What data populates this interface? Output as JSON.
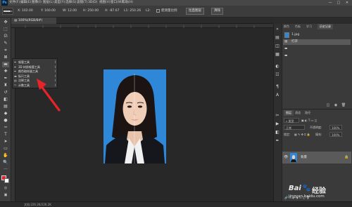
{
  "app": {
    "logo_text": "Ps"
  },
  "menubar": {
    "items": [
      "文件(F)",
      "编辑(E)",
      "图像(I)",
      "图层(L)",
      "类型(Y)",
      "选择(S)",
      "滤镜(T)",
      "3D(D)",
      "视图(V)",
      "窗口(W)",
      "帮助(H)"
    ],
    "window_controls": [
      "—",
      "□",
      "✕"
    ]
  },
  "options": {
    "x_field": "X: 102.00",
    "y_field": "Y: 160.00",
    "w_field": "W: 12.00",
    "h_field": "H: 250.00",
    "a_field": "A: -87.67",
    "l_field": "L1: 250.26",
    "l2_field": "L2:",
    "scale_label": "使测量比例",
    "straighten_button": "拉直图层",
    "clear_button": "清除"
  },
  "document": {
    "tab_label": "@ 100%(RGB/8#)"
  },
  "tools": [
    {
      "icon": "move-icon",
      "glyph": "✥"
    },
    {
      "icon": "marquee-icon",
      "glyph": "⬚"
    },
    {
      "icon": "lasso-icon",
      "glyph": "ᘏ"
    },
    {
      "icon": "quick-select-icon",
      "glyph": "✎"
    },
    {
      "icon": "crop-icon",
      "glyph": "⌗"
    },
    {
      "icon": "frame-icon",
      "glyph": "⊠"
    },
    {
      "icon": "ruler-icon",
      "glyph": "▬"
    },
    {
      "icon": "healing-icon",
      "glyph": "✚"
    },
    {
      "icon": "brush-icon",
      "glyph": "✒"
    },
    {
      "icon": "stamp-icon",
      "glyph": "♜"
    },
    {
      "icon": "history-brush-icon",
      "glyph": "↺"
    },
    {
      "icon": "eraser-icon",
      "glyph": "◧"
    },
    {
      "icon": "gradient-icon",
      "glyph": "▤"
    },
    {
      "icon": "blur-icon",
      "glyph": "◆"
    },
    {
      "icon": "dodge-icon",
      "glyph": "●"
    },
    {
      "icon": "pen-icon",
      "glyph": "✑"
    },
    {
      "icon": "type-icon",
      "glyph": "T"
    },
    {
      "icon": "path-select-icon",
      "glyph": "➤"
    },
    {
      "icon": "shape-icon",
      "glyph": "▭"
    },
    {
      "icon": "hand-icon",
      "glyph": "✋"
    },
    {
      "icon": "zoom-icon",
      "glyph": "🔍"
    },
    {
      "icon": "more-icon",
      "glyph": "···"
    }
  ],
  "flyout": {
    "items": [
      {
        "icon": "eyedropper-icon",
        "glyph": "✒",
        "label": "吸管工具",
        "key": "I"
      },
      {
        "icon": "3d-material-eyedropper-icon",
        "glyph": "✒",
        "label": "3D 材质吸管工具",
        "key": "I"
      },
      {
        "icon": "color-sampler-icon",
        "glyph": "✒",
        "label": "颜色取样器工具",
        "key": "I"
      },
      {
        "icon": "ruler-icon",
        "glyph": "▬",
        "label": "标尺工具",
        "key": "I"
      },
      {
        "icon": "note-icon",
        "glyph": "▤",
        "label": "注释工具",
        "key": "I"
      },
      {
        "icon": "count-icon",
        "glyph": "¹²",
        "label": "计数工具",
        "key": "I"
      }
    ]
  },
  "right_panel": {
    "top_tabs": [
      "颜色",
      "色板",
      "学习",
      "历史记录"
    ],
    "history": {
      "snapshot": "1.jpg",
      "rows": [
        "打开",
        "",
        ""
      ]
    },
    "layers_tabs": [
      "图层",
      "通道",
      "路径"
    ],
    "filter_label": "类型",
    "blend_mode": "正常",
    "opacity_label": "不透明度:",
    "opacity_value": "100%",
    "lock_label": "锁定:",
    "fill_label": "填充:",
    "fill_value": "100%",
    "layer_name": "背景"
  },
  "status": {
    "text": "文档:226.2K/226.2K"
  },
  "watermark": {
    "brand": "Bai",
    "paw": "🐾",
    "brand2": "经验",
    "site": "jingyan.baidu.com"
  },
  "colors": {
    "accent_red": "#e8242a",
    "photo_blue": "#2f87d8"
  }
}
